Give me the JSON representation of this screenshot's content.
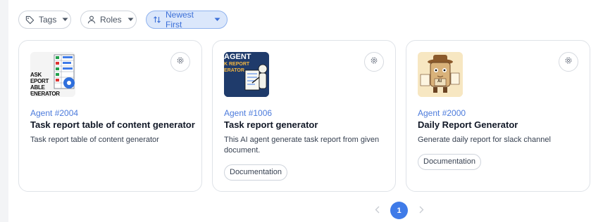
{
  "filters": {
    "tags_label": "Tags",
    "roles_label": "Roles",
    "sort_label": "Newest First"
  },
  "cards": [
    {
      "id_label": "Agent #2004",
      "title": "Task report table of content generator",
      "description": "Task report table of content generator",
      "thumbnail_text": [
        "ASK",
        "EPORT",
        "ABLE",
        "ENERATOR"
      ],
      "tags": []
    },
    {
      "id_label": "Agent #1006",
      "title": "Task report generator",
      "description": "This AI agent generate task report from given document.",
      "thumbnail_text": [
        "AGENT",
        "K REPORT",
        "ERATOR"
      ],
      "tags": [
        "Documentation"
      ]
    },
    {
      "id_label": "Agent #2000",
      "title": "Daily Report Generator",
      "description": "Generate daily report for slack channel",
      "thumbnail_text": [
        "AI"
      ],
      "tags": [
        "Documentation"
      ]
    }
  ],
  "pagination": {
    "current_page": "1",
    "prev_icon": "chevron-left-icon",
    "next_icon": "chevron-right-icon"
  },
  "colors": {
    "accent": "#3f7be8",
    "active_filter_bg": "#dbe7fb",
    "agent_id": "#4c7bdc"
  }
}
